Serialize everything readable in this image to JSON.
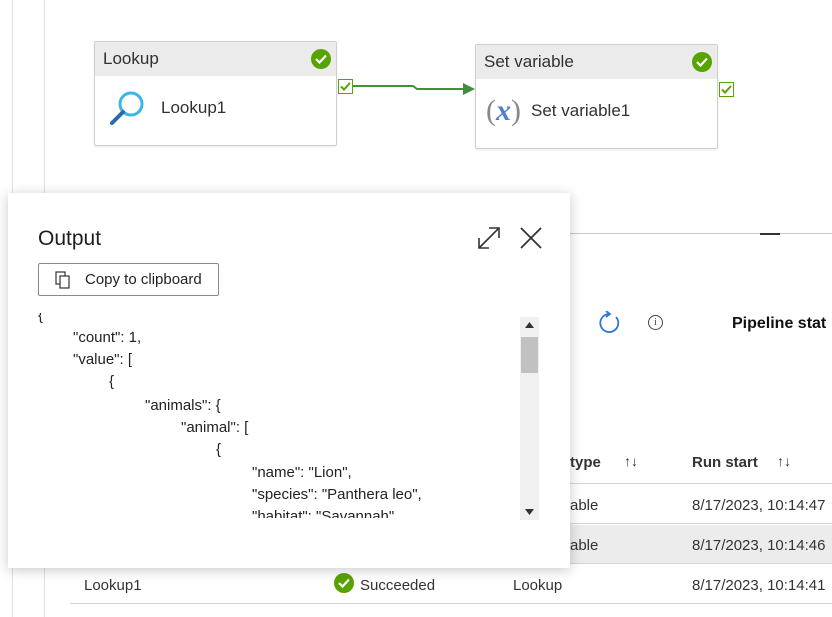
{
  "canvas": {
    "lookup_activity": {
      "header": "Lookup",
      "name": "Lookup1",
      "icon": "search-icon",
      "status_icon": "check-circle-icon"
    },
    "set_variable_activity": {
      "header": "Set variable",
      "name": "Set variable1",
      "icon": "variable-x-icon",
      "status_icon": "check-circle-icon"
    },
    "connector": "arrow-right-icon"
  },
  "pipeline": {
    "status_title": "Pipeline stat",
    "refresh_icon": "refresh-icon",
    "info_icon": "info-icon",
    "info_glyph": "i"
  },
  "table": {
    "headers": {
      "type": "type",
      "run_start": "Run start"
    },
    "sort_glyph": "↑↓",
    "rows": [
      {
        "type": "able",
        "run_start": "8/17/2023, 10:14:47"
      },
      {
        "type": "able",
        "run_start": "8/17/2023, 10:14:46"
      },
      {
        "name": "Lookup1",
        "status": "Succeeded",
        "type": "Lookup",
        "run_start": "8/17/2023, 10:14:41"
      }
    ]
  },
  "output_panel": {
    "title": "Output",
    "copy_label": "Copy to clipboard",
    "json_lines": [
      "{",
      "\"count\": 1,",
      "\"value\": [",
      "{",
      "\"animals\": {",
      "\"animal\": [",
      "{",
      "\"name\": \"Lion\",",
      "\"species\": \"Panthera leo\",",
      "\"habitat\": \"Savannah\""
    ]
  },
  "colors": {
    "success": "#57a300",
    "connector": "#3f8f3f",
    "variable_icon": "#4a7fd1",
    "search_icon": "#3ab7e6"
  }
}
